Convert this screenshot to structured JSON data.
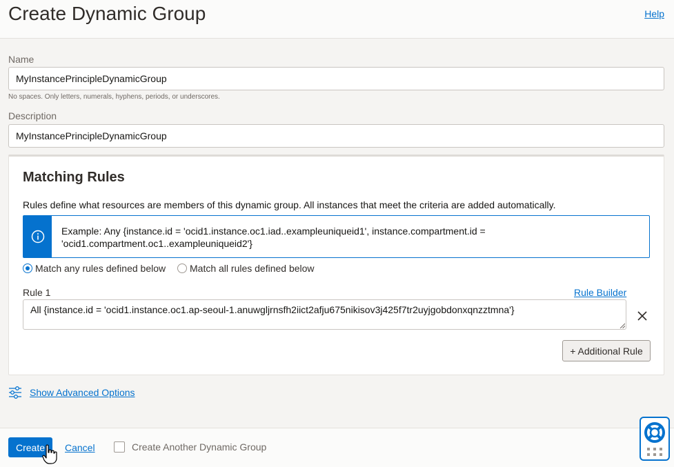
{
  "header": {
    "title": "Create Dynamic Group",
    "help_label": "Help"
  },
  "form": {
    "name_label": "Name",
    "name_value": "MyInstancePrincipleDynamicGroup",
    "name_hint": "No spaces. Only letters, numerals, hyphens, periods, or underscores.",
    "description_label": "Description",
    "description_value": "MyInstancePrincipleDynamicGroup"
  },
  "rules": {
    "title": "Matching Rules",
    "description": "Rules define what resources are members of this dynamic group. All instances that meet the criteria are added automatically.",
    "example_line1": "Example: Any {instance.id = 'ocid1.instance.oc1.iad..exampleuniqueid1', instance.compartment.id =",
    "example_line2": "'ocid1.compartment.oc1..exampleuniqueid2'}",
    "match_any_label": "Match any rules defined below",
    "match_all_label": "Match all rules defined below",
    "match_selected": "any",
    "rule1_label": "Rule 1",
    "rule_builder_label": "Rule Builder",
    "rule1_value": "All {instance.id = 'ocid1.instance.oc1.ap-seoul-1.anuwgljrnsfh2iict2afju675nikisov3j425f7tr2uyjgobdonxqnzztmna'}",
    "add_rule_label": "+ Additional Rule"
  },
  "advanced": {
    "label": "Show Advanced Options"
  },
  "footer": {
    "create_label": "Create",
    "cancel_label": "Cancel",
    "create_another_label": "Create Another Dynamic Group"
  },
  "colors": {
    "accent": "#0572ce",
    "background": "#f5f4f2",
    "text": "#161513"
  },
  "icons": [
    "info-icon",
    "close-icon",
    "sliders-icon",
    "lifebuoy-icon",
    "grid-dots-icon",
    "hand-cursor-icon"
  ]
}
